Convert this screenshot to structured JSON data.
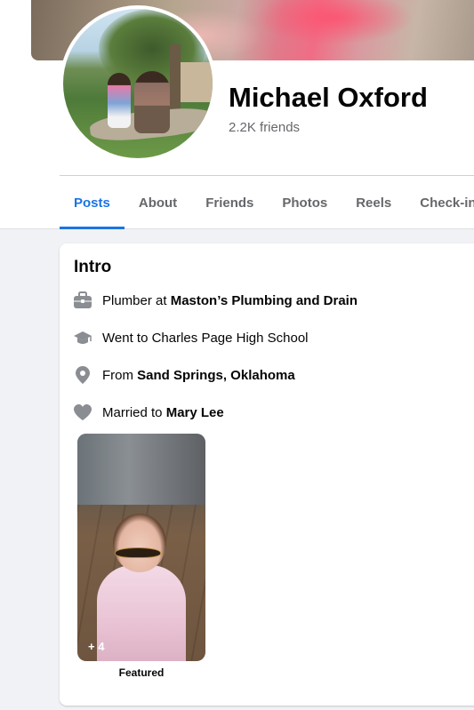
{
  "profile": {
    "name": "Michael Oxford",
    "friends": "2.2K friends"
  },
  "tabs": [
    {
      "label": "Posts",
      "active": true
    },
    {
      "label": "About",
      "active": false
    },
    {
      "label": "Friends",
      "active": false
    },
    {
      "label": "Photos",
      "active": false
    },
    {
      "label": "Reels",
      "active": false
    },
    {
      "label": "Check-ins",
      "active": false
    }
  ],
  "intro": {
    "title": "Intro",
    "items": [
      {
        "icon": "briefcase-icon",
        "prefix": "Plumber at ",
        "bold": "Maston’s Plumbing and Drain"
      },
      {
        "icon": "graduation-cap-icon",
        "prefix": "Went to Charles Page High School",
        "bold": ""
      },
      {
        "icon": "location-pin-icon",
        "prefix": "From ",
        "bold": "Sand Springs, Oklahoma"
      },
      {
        "icon": "heart-icon",
        "prefix": "Married to ",
        "bold": "Mary Lee"
      }
    ],
    "featured": {
      "count": "+ 4",
      "label": "Featured"
    }
  },
  "colors": {
    "accent": "#1b74e4",
    "secondary_text": "#65676b",
    "icon_gray": "#8a8d91"
  }
}
